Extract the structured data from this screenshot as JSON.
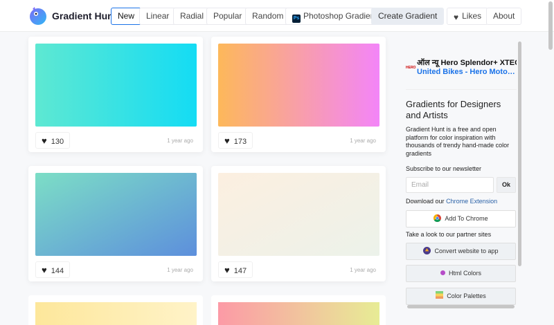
{
  "header": {
    "brand": "Gradient Hunt",
    "nav": [
      "New",
      "Linear",
      "Radial",
      "Popular",
      "Random"
    ],
    "photoshop_label": "Photoshop Gradients",
    "photoshop_icon": "Ps",
    "create_label": "Create Gradient",
    "likes_label": "Likes",
    "about_label": "About"
  },
  "gradients": [
    {
      "likes": "130",
      "ago": "1 year ago",
      "from": "#5ee8d2",
      "to": "#14dcf4",
      "dir": "to right"
    },
    {
      "likes": "173",
      "ago": "1 year ago",
      "from": "#fdb85a",
      "to": "#f385f8",
      "dir": "to right"
    },
    {
      "likes": "144",
      "ago": "1 year ago",
      "from": "#7cdec6",
      "to": "#5d8fdc",
      "dir": "to bottom right"
    },
    {
      "likes": "147",
      "ago": "1 year ago",
      "from": "#fcefe0",
      "to": "#ecf2ea",
      "dir": "to bottom right"
    },
    {
      "from": "#fde79b",
      "to": "#fff3c8",
      "dir": "to right"
    },
    {
      "from": "#fc9aa6",
      "to": "#e7ec95",
      "dir": "to right"
    }
  ],
  "sidebar": {
    "ad_logo": "HERO",
    "ad_line1": "ऑल न्यू Hero Splendor+ XTEC",
    "ad_line2": "United Bikes - Hero MotoCorp",
    "title": "Gradients for Designers and Artists",
    "description": "Gradient Hunt is a free and open platform for color inspiration with thousands of trendy hand-made color gradients",
    "subscribe": "Subscribe to our newsletter",
    "email_placeholder": "Email",
    "ok_label": "Ok",
    "download_prefix": "Download our",
    "download_link": "Chrome Extension",
    "add_chrome": "Add To Chrome",
    "partner": "Take a look to our partner sites",
    "partners": [
      "Convert website to app",
      "Html Colors",
      "Color Palettes"
    ]
  }
}
